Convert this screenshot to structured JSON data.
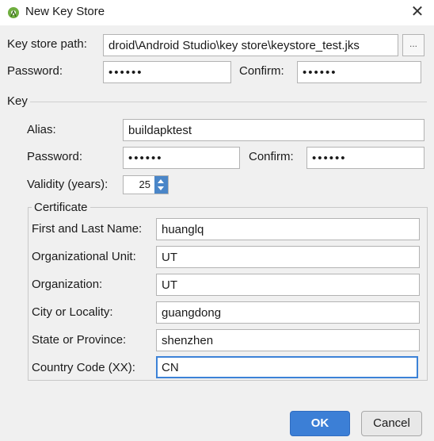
{
  "window": {
    "title": "New Key Store",
    "app_icon": "android-studio-icon",
    "close_glyph": "✕"
  },
  "keystore": {
    "path_label": "Key store path:",
    "path_value": "droid\\Android Studio\\key store\\keystore_test.jks",
    "browse_glyph": "...",
    "password_label": "Password:",
    "password_value": "123456",
    "confirm_label": "Confirm:",
    "confirm_value": "123456"
  },
  "key": {
    "section_label": "Key",
    "alias_label": "Alias:",
    "alias_value": "buildapktest",
    "password_label": "Password:",
    "password_value": "123456",
    "confirm_label": "Confirm:",
    "confirm_value": "123456",
    "validity_label": "Validity (years):",
    "validity_value": "25"
  },
  "certificate": {
    "section_label": "Certificate",
    "fields": [
      {
        "label": "First and Last Name:",
        "value": "huanglq"
      },
      {
        "label": "Organizational Unit:",
        "value": "UT"
      },
      {
        "label": "Organization:",
        "value": "UT"
      },
      {
        "label": "City or Locality:",
        "value": "guangdong"
      },
      {
        "label": "State or Province:",
        "value": "shenzhen"
      },
      {
        "label": "Country Code (XX):",
        "value": "CN"
      }
    ]
  },
  "buttons": {
    "ok": "OK",
    "cancel": "Cancel"
  },
  "colors": {
    "accent": "#3c7fd6",
    "background": "#f0f0f0"
  }
}
